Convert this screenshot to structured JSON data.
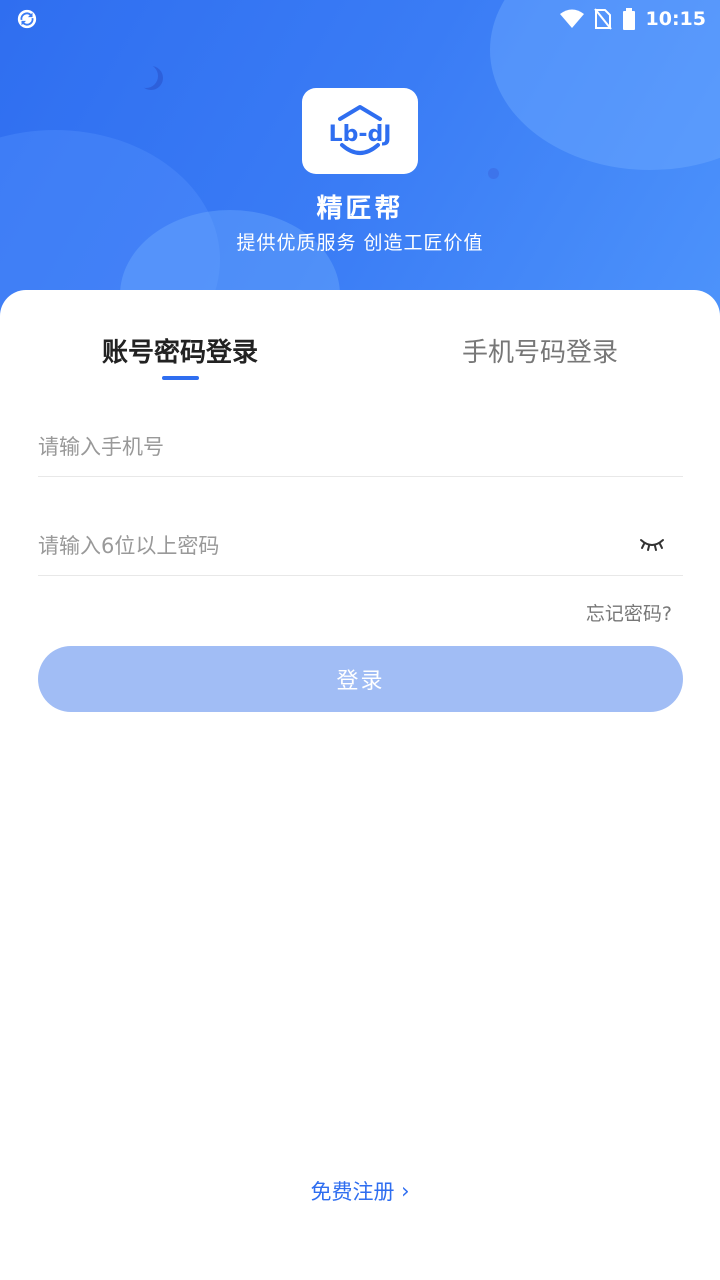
{
  "status_bar": {
    "time": "10:15"
  },
  "app": {
    "name": "精匠帮",
    "slogan": "提供优质服务  创造工匠价值",
    "logo_text": "Lb-dJ"
  },
  "tabs": {
    "account_login": "账号密码登录",
    "phone_login": "手机号码登录"
  },
  "form": {
    "phone_placeholder": "请输入手机号",
    "password_placeholder": "请输入6位以上密码",
    "forgot_password": "忘记密码?",
    "login_button": "登录"
  },
  "footer": {
    "register": "免费注册",
    "register_arrow": "›"
  },
  "colors": {
    "primary": "#2f6ef0",
    "button_disabled": "#a1bdf5"
  }
}
